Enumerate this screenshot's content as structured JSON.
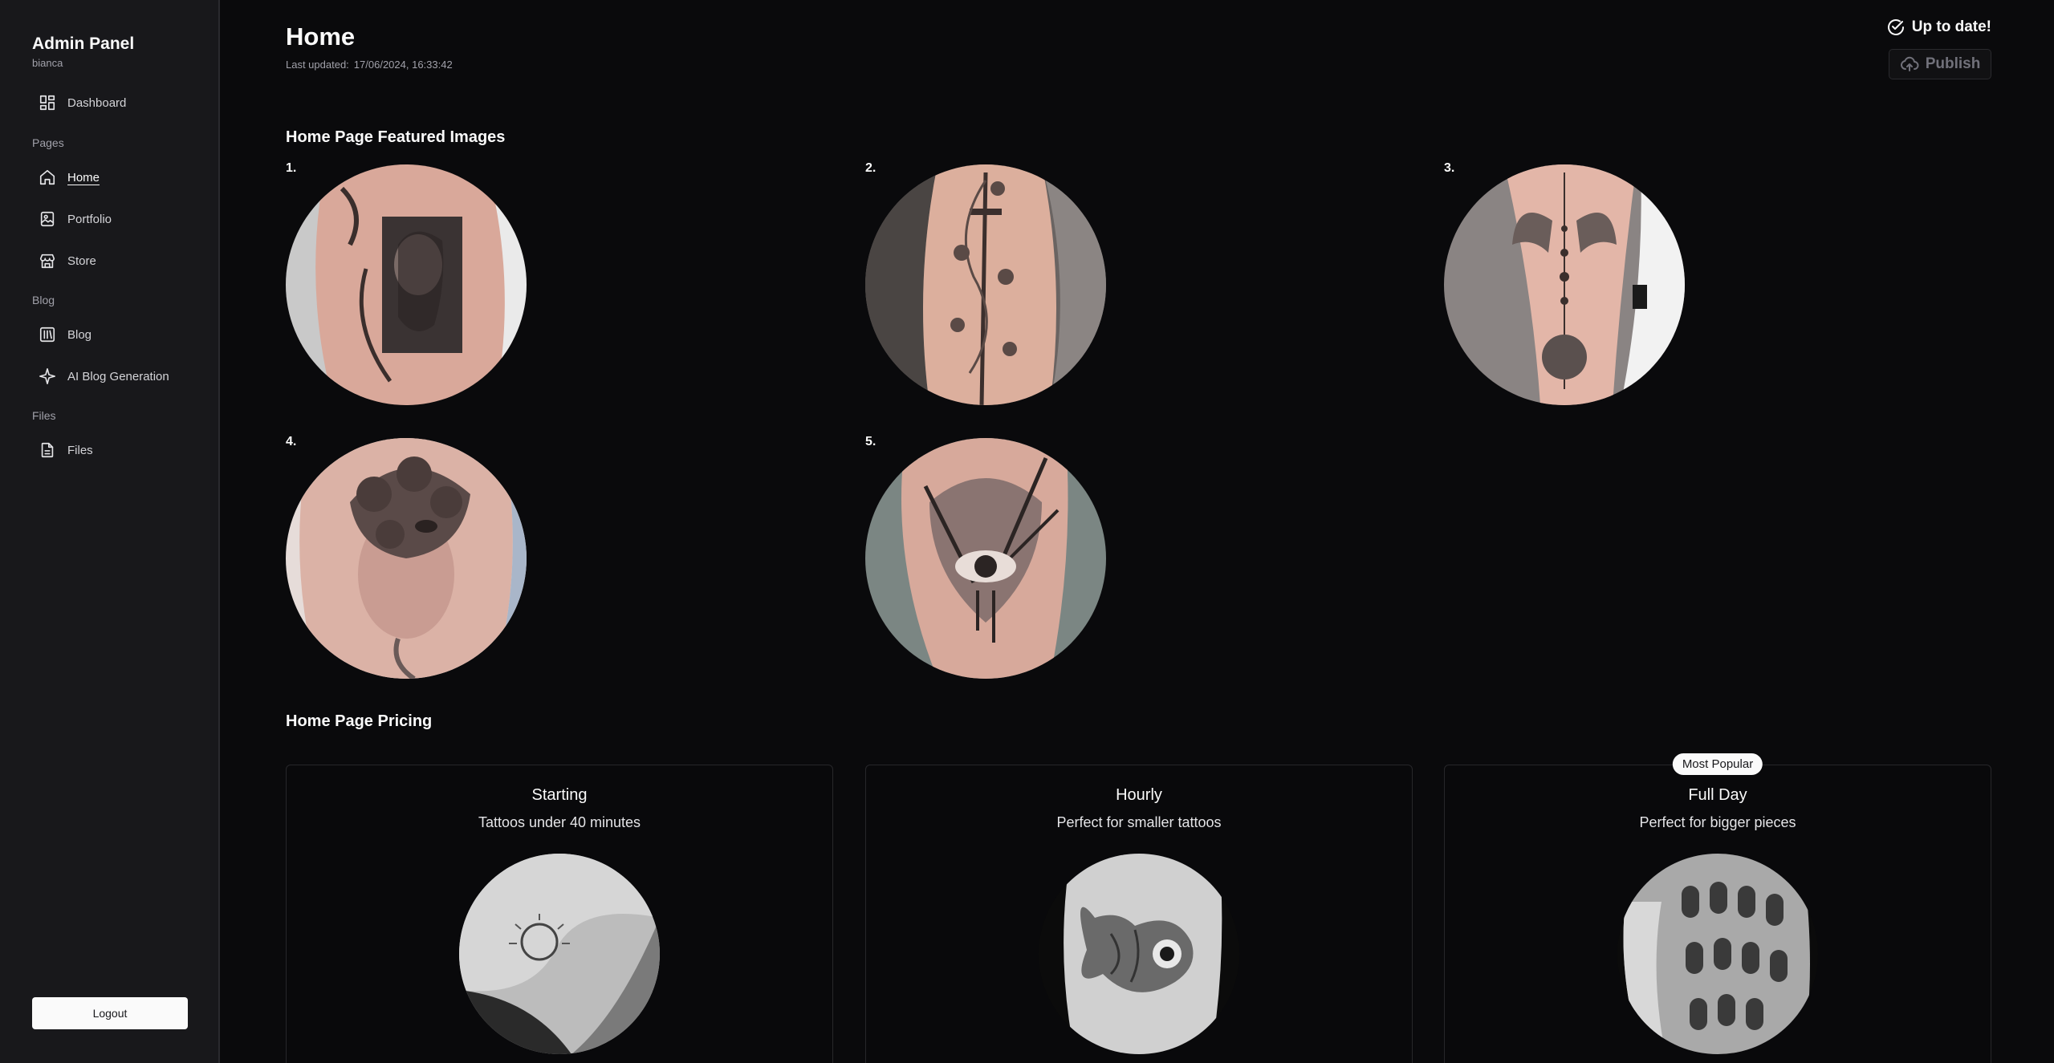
{
  "sidebar": {
    "title": "Admin Panel",
    "user": "bianca",
    "dashboard": "Dashboard",
    "sections": {
      "pages": "Pages",
      "blog": "Blog",
      "files": "Files"
    },
    "pages_items": [
      "Home",
      "Portfolio",
      "Store"
    ],
    "blog_items": [
      "Blog",
      "AI Blog Generation"
    ],
    "files_items": [
      "Files"
    ],
    "active": "Home",
    "logout": "Logout"
  },
  "header": {
    "title": "Home",
    "last_updated_label": "Last updated:",
    "last_updated_value": "17/06/2024, 16:33:42",
    "status": "Up to date!",
    "publish": "Publish"
  },
  "featured": {
    "title": "Home Page Featured Images",
    "items": [
      {
        "num": "1.",
        "icon": "tattoo-portrait-image"
      },
      {
        "num": "2.",
        "icon": "tattoo-sword-vine-image"
      },
      {
        "num": "3.",
        "icon": "tattoo-moon-phases-image"
      },
      {
        "num": "4.",
        "icon": "tattoo-flower-face-image"
      },
      {
        "num": "5.",
        "icon": "tattoo-eye-daggers-image"
      }
    ]
  },
  "pricing": {
    "title": "Home Page Pricing",
    "cards": [
      {
        "name": "Starting",
        "desc": "Tattoos under 40 minutes",
        "badge": ""
      },
      {
        "name": "Hourly",
        "desc": "Perfect for smaller tattoos",
        "badge": ""
      },
      {
        "name": "Full Day",
        "desc": "Perfect for bigger pieces",
        "badge": "Most Popular"
      }
    ]
  },
  "colors": {
    "background": "#0a0a0c",
    "sidebar": "#18181b",
    "text": "#fafafa",
    "muted": "#a1a1aa"
  }
}
